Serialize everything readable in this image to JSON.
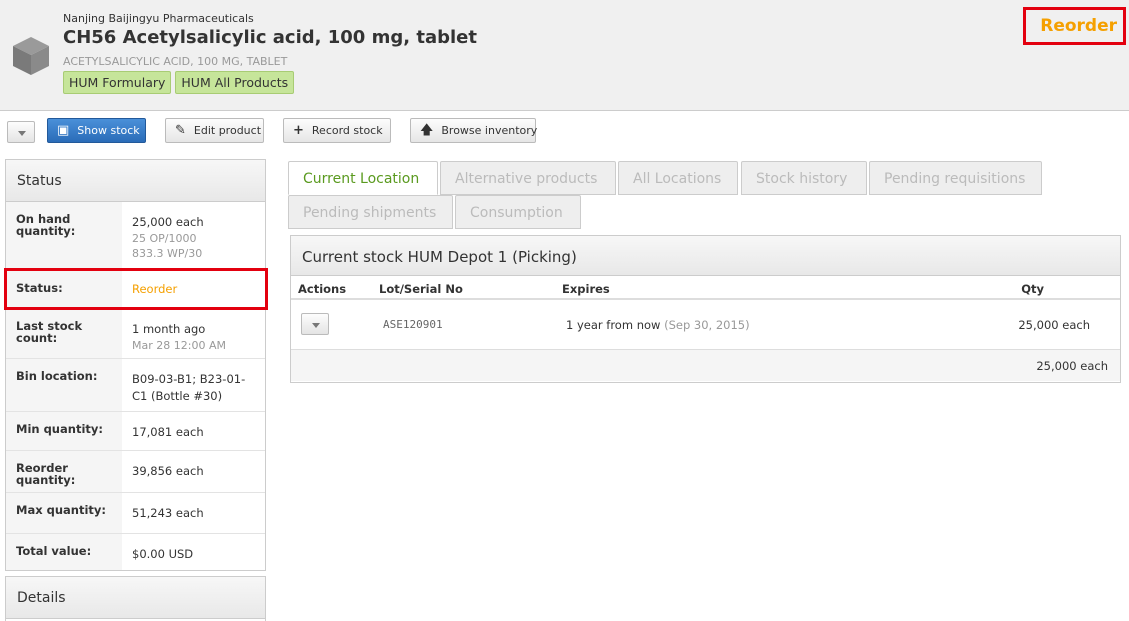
{
  "product": {
    "supplier": "Nanjing Baijingyu Pharmaceuticals",
    "title": "CH56 Acetylsalicylic acid, 100 mg, tablet",
    "generic_name": "ACETYLSALICYLIC ACID, 100 MG, TABLET",
    "tags": [
      "HUM Formulary",
      "HUM All Products"
    ],
    "status_badge": "Reorder"
  },
  "toolbar": {
    "show_stock": "Show stock",
    "edit_product": "Edit product",
    "record_stock": "Record stock",
    "browse_inventory": "Browse inventory"
  },
  "status_panel": {
    "title": "Status",
    "rows": [
      {
        "label": "On hand quantity:",
        "value": "25,000 each",
        "sub1": "25 OP/1000",
        "sub2": "833.3 WP/30"
      },
      {
        "label": "Status:",
        "value": "Reorder"
      },
      {
        "label": "Last stock count:",
        "value": "1 month ago",
        "sub1": "Mar 28 12:00 AM"
      },
      {
        "label": "Bin location:",
        "value": "B09-03-B1; B23-01-C1 (Bottle #30)"
      },
      {
        "label": "Min quantity:",
        "value": "17,081 each"
      },
      {
        "label": "Reorder quantity:",
        "value": "39,856 each"
      },
      {
        "label": "Max quantity:",
        "value": "51,243 each"
      },
      {
        "label": "Total value:",
        "value": "$0.00 USD"
      }
    ]
  },
  "details_panel": {
    "title": "Details"
  },
  "tabs": [
    "Current Location",
    "Alternative products",
    "All Locations",
    "Stock history",
    "Pending requisitions",
    "Pending shipments",
    "Consumption"
  ],
  "stock": {
    "title": "Current stock HUM Depot 1 (Picking)",
    "columns": [
      "Actions",
      "Lot/Serial No",
      "Expires",
      "Qty"
    ],
    "rows": [
      {
        "lot": "ASE120901",
        "expires": "1 year from now",
        "expires_date": "(Sep 30, 2015)",
        "qty": "25,000 each"
      }
    ],
    "total": "25,000 each"
  },
  "colors": {
    "accent_orange": "#f5a000",
    "highlight_red": "#e3000f",
    "tag_green": "#c6e59a",
    "active_tab_green": "#5a9a1f",
    "primary_blue": "#2a6cb8"
  }
}
